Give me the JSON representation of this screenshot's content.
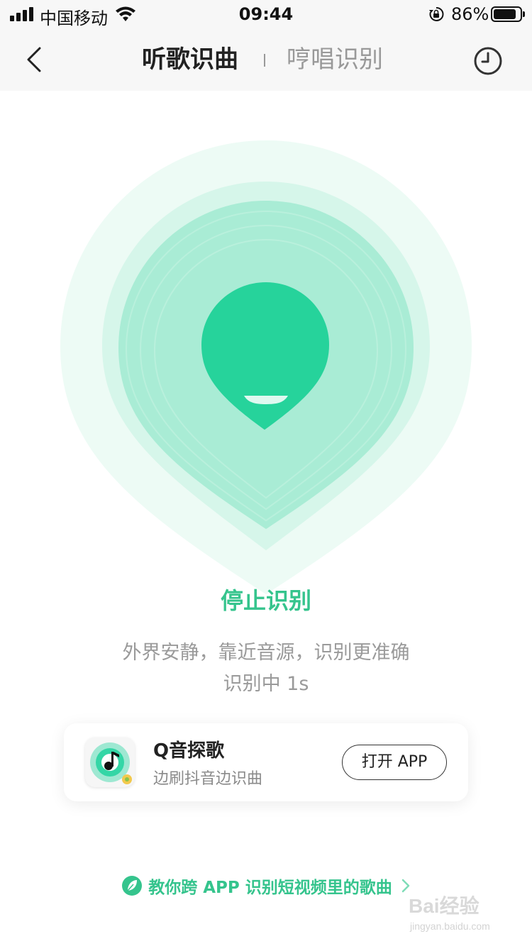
{
  "status_bar": {
    "carrier": "中国移动",
    "time": "09:44",
    "battery_percent": "86%",
    "battery_level": 0.86,
    "signal_bars": 4,
    "icons": [
      "signal-icon",
      "wifi-icon",
      "orientation-lock-icon",
      "battery-icon"
    ]
  },
  "nav": {
    "back_icon": "chevron-left-icon",
    "tabs": [
      {
        "label": "听歌识曲",
        "active": true
      },
      {
        "label": "哼唱识别",
        "active": false
      }
    ],
    "history_icon": "clock-icon"
  },
  "recognition": {
    "action_label": "停止识别",
    "hint": "外界安静，靠近音源，识别更准确",
    "progress": "识别中 1s",
    "colors": {
      "accent": "#35c48d",
      "core": "#26d39b",
      "ring_outer": "#edfbf5",
      "ring_mid": "#d6f6ea",
      "ring_inner": "#a9ecd5"
    }
  },
  "promo": {
    "app_name": "Q音探歌",
    "app_desc": "边刷抖音边识曲",
    "button_label": "打开 APP",
    "icon": "music-note-icon"
  },
  "tip": {
    "text": "教你跨 APP 识别短视频里的歌曲",
    "icon": "leaf-icon",
    "chevron": "chevron-right-icon"
  },
  "watermark": {
    "text": "Bai经验",
    "sub": "jingyan.baidu.com"
  }
}
